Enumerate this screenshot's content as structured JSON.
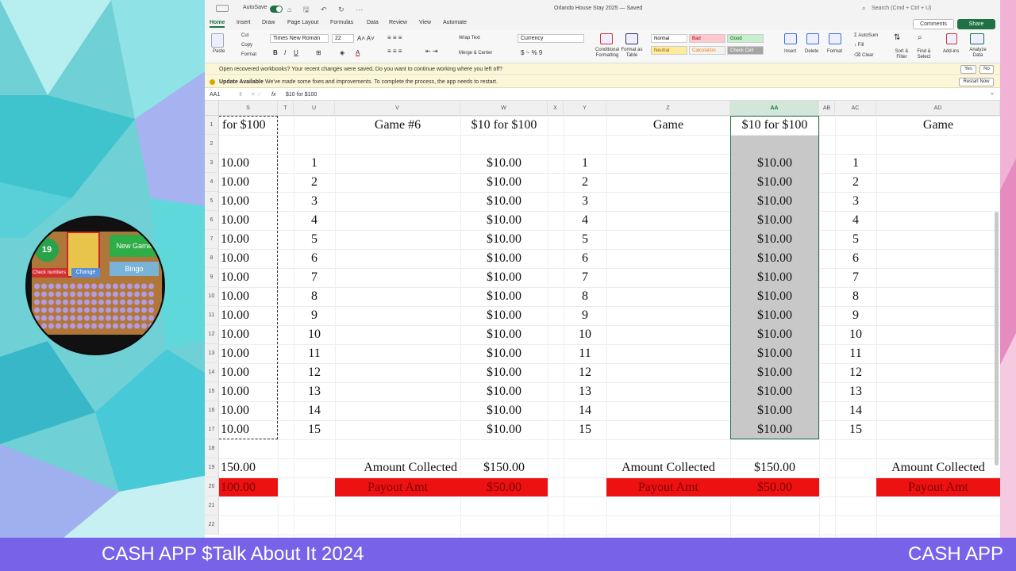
{
  "window": {
    "autosave_label": "AutoSave",
    "title": "Orlando House Stay 2025 — Saved",
    "search_placeholder": "Search (Cmd + Ctrl + U)",
    "comments_label": "Comments",
    "share_label": "Share"
  },
  "ribbon_tabs": [
    "Home",
    "Insert",
    "Draw",
    "Page Layout",
    "Formulas",
    "Data",
    "Review",
    "View",
    "Automate"
  ],
  "ribbon": {
    "paste": "Paste",
    "cut": "Cut",
    "copy": "Copy",
    "format": "Format",
    "font_name": "Times New Roman",
    "font_size": "22",
    "wrap_text": "Wrap Text",
    "merge_center": "Merge & Center",
    "number_format": "Currency",
    "currency_symbols": "$ ~ % 9",
    "conditional_formatting": "Conditional Formatting",
    "format_as_table": "Format as Table",
    "styles": [
      "Normal",
      "Bad",
      "Good",
      "Neutral",
      "Calculation",
      "Check Cell"
    ],
    "insert": "Insert",
    "delete": "Delete",
    "format_cells": "Format",
    "autosum": "AutoSum",
    "fill": "Fill",
    "clear": "Clear",
    "sort_filter": "Sort & Filter",
    "find_select": "Find & Select",
    "addins": "Add-ins",
    "analyze_data": "Analyze Data"
  },
  "notices": {
    "recover": "Open recovered workbooks?  Your recent changes were saved. Do you want to continue working where you left off?",
    "yes": "Yes",
    "no": "No",
    "update_title": "Update Available",
    "update_text": "We've made some fixes and improvements. To complete the process, the app needs to restart.",
    "restart": "Restart Now"
  },
  "formula_bar": {
    "name_box": "AA1",
    "fx": "fx",
    "content": "$10 for $100"
  },
  "columns": [
    "S",
    "T",
    "U",
    "V",
    "W",
    "X",
    "Y",
    "Z",
    "AA",
    "AB",
    "AC",
    "AD"
  ],
  "rows": [
    "1",
    "2",
    "3",
    "4",
    "5",
    "6",
    "7",
    "8",
    "9",
    "10",
    "11",
    "12",
    "13",
    "14",
    "15",
    "16",
    "17",
    "18",
    "19",
    "20",
    "21",
    "22"
  ],
  "sheet": {
    "s_header": "for $100",
    "s_values": [
      "10.00",
      "10.00",
      "10.00",
      "10.00",
      "10.00",
      "10.00",
      "10.00",
      "10.00",
      "10.00",
      "10.00",
      "10.00",
      "10.00",
      "10.00",
      "10.00",
      "10.00"
    ],
    "s_total": "150.00",
    "s_payout": "100.00",
    "game6_label": "Game #6",
    "w_header": "$10 for $100",
    "z_header": "Game",
    "aa_header": "$10 for $100",
    "ad_header": "Game",
    "numbers": [
      "1",
      "2",
      "3",
      "4",
      "5",
      "6",
      "7",
      "8",
      "9",
      "10",
      "11",
      "12",
      "13",
      "14",
      "15"
    ],
    "money": [
      "$10.00",
      "$10.00",
      "$10.00",
      "$10.00",
      "$10.00",
      "$10.00",
      "$10.00",
      "$10.00",
      "$10.00",
      "$10.00",
      "$10.00",
      "$10.00",
      "$10.00",
      "$10.00",
      "$10.00"
    ],
    "amount_collected": "Amount Collected",
    "total": "$150.00",
    "payout_label": "Payout Amt",
    "payout_value": "$50.00"
  },
  "overlay": {
    "cam_number": "19",
    "new_game": "New Game",
    "bingo": "Bingo",
    "check_numbers": "Check numbers",
    "change": "Change"
  },
  "banner": {
    "left": "CASH APP $Talk About It 2024",
    "right": "CASH APP"
  },
  "colors": {
    "excel_green": "#1e7145",
    "payout_red": "#ee1111",
    "banner_purple": "#7862e8",
    "selection_gray": "#c8c8c8"
  }
}
